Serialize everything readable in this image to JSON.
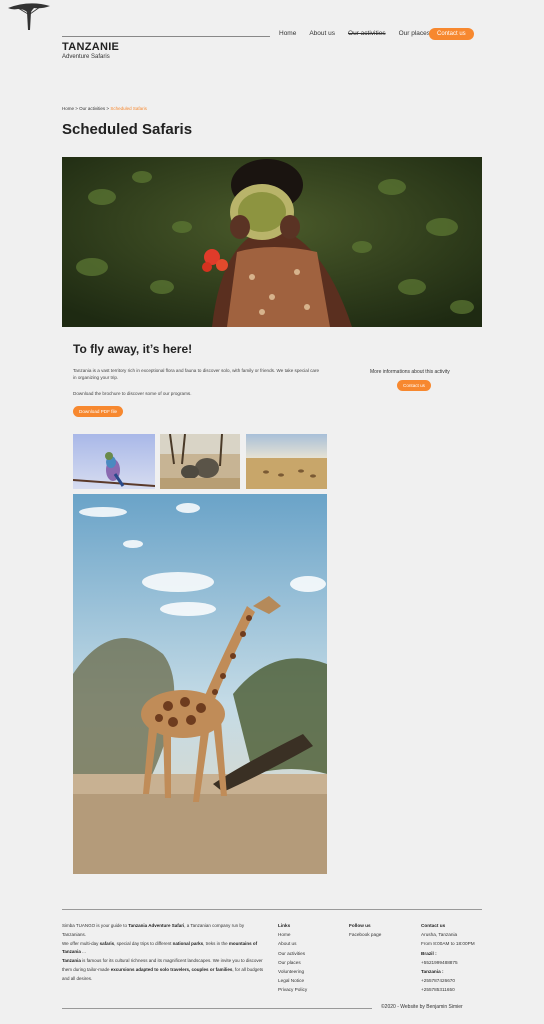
{
  "logo": {
    "title": "TANZANIE",
    "subtitle": "Adventure Safaris"
  },
  "nav": {
    "items": [
      "Home",
      "About us",
      "Our activities",
      "Our places"
    ],
    "contact_label": "Contact us"
  },
  "breadcrumb": {
    "home": "Home",
    "sep1": " > ",
    "section": "Our activities",
    "sep2": " > ",
    "current": "Scheduled Safaris"
  },
  "page_title": "Scheduled Safaris",
  "intro": {
    "title": "To fly away, it’s here!",
    "description": "Tanzania is a vast territory rich in exceptional flora and fauna to discover solo, with family or friends. We take special care in organizing your trip.",
    "brochure_text": "Download the brochure to discover some of our programs.",
    "download_label": "Download PDF file"
  },
  "sidebar": {
    "more_info": "More informations about this activity",
    "contact_label": "Contact us"
  },
  "footer": {
    "about": {
      "p1_a": "Simba TUANGO is your guide to ",
      "p1_b": "Tanzania Adventure Safari",
      "p1_c": ", a Tanzanian company run by Tanzanians.",
      "p2_a": "We offer multi-day ",
      "p2_b": "safaris",
      "p2_c": ", special day trips to different ",
      "p2_d": "national parks",
      "p2_e": ", treks in the ",
      "p2_f": "mountains of Tanzania",
      "p2_g": " ...",
      "p3_a": "Tanzania",
      "p3_b": " is famous for its cultural richness and its magnificent landscapes. We invite you to discover them during tailor-made ",
      "p3_c": "excursions adapted to solo travelers, couples or families",
      "p3_d": ", for all budgets and all desires."
    },
    "links": {
      "heading": "Links",
      "items": [
        "Home",
        "About us",
        "Our activities",
        "Our places",
        "Volunteering",
        "Legal Notice",
        "Privacy Policy"
      ]
    },
    "follow": {
      "heading": "Follow us",
      "items": [
        "Facebook page"
      ]
    },
    "contact": {
      "heading": "Contact us",
      "address": "Arusha, Tanzania",
      "hours": "From 8:00AM to 18:00PM",
      "brazil_label": "Brazil :",
      "brazil_phone": "+5521999488875",
      "tanzania_label": "Tanzania :",
      "tanzania_phone1": "+255787426670",
      "tanzania_phone2": "+255785311650"
    },
    "copyright": "©2020 - Website by Benjamin Simier"
  },
  "colors": {
    "accent": "#f7882f",
    "background": "#f0f0f0"
  }
}
